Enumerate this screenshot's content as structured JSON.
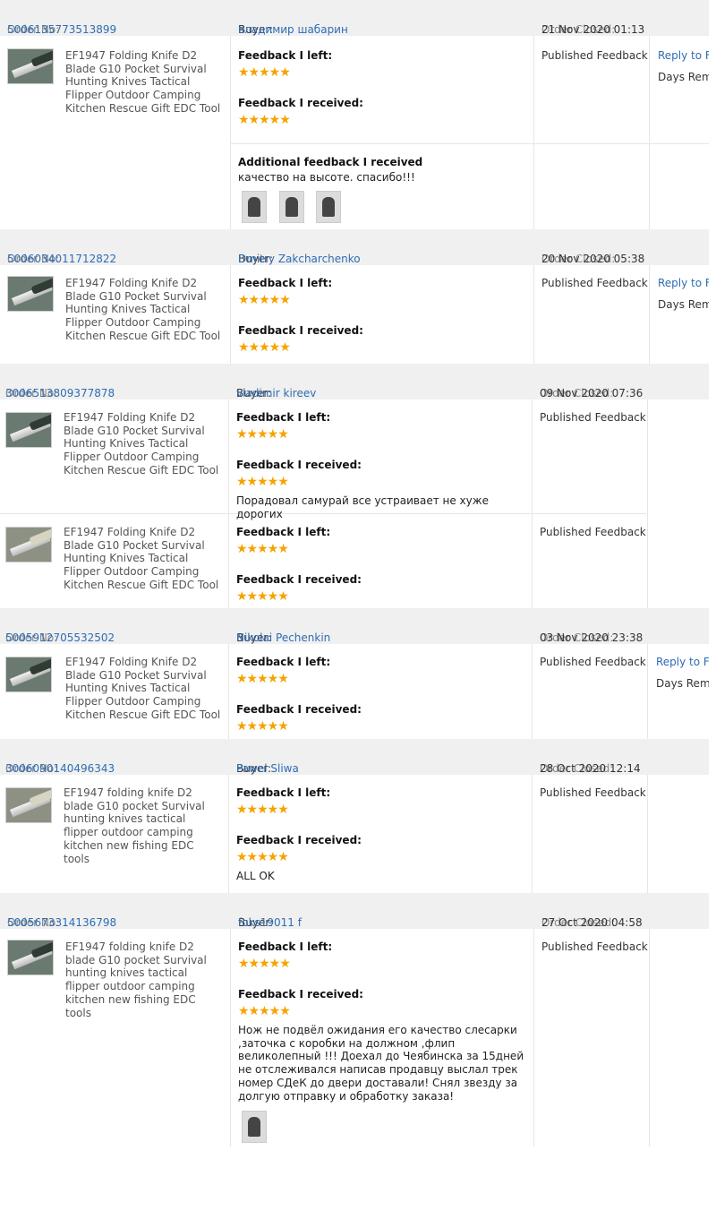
{
  "labels": {
    "order_no": "Order No:",
    "buyer": "Buyer:",
    "order_closed": "Order Closed:",
    "feedback_left": "Feedback I left:",
    "feedback_received": "Feedback I received:",
    "additional_feedback": "Additional feedback I received",
    "published": "Published Feedback",
    "reply": "Reply to Fe",
    "days": "Days Rema"
  },
  "orders": [
    {
      "order_no": "5006135773513899",
      "buyer": "владимир шабарин",
      "closed": "21 Nov 2020 01:13",
      "items": [
        {
          "title": "EF1947 Folding Knife D2 Blade G10 Pocket Survival Hunting Knives Tactical Flipper Outdoor Camping Kitchen Rescue Gift EDC Tool",
          "stars_left": "★★★★★",
          "stars_received": "★★★★★",
          "additional": "качество на высоте. спасибо!!!"
        }
      ]
    },
    {
      "order_no": "5006034011712822",
      "buyer": "Dmitry Zakcharchenko",
      "closed": "20 Nov 2020 05:38",
      "items": [
        {
          "title": "EF1947 Folding Knife D2 Blade G10 Pocket Survival Hunting Knives Tactical Flipper Outdoor Camping Kitchen Rescue Gift EDC Tool",
          "stars_left": "★★★★★",
          "stars_received": "★★★★★"
        }
      ]
    },
    {
      "order_no": "3006513809377878",
      "buyer": "vladimir kireev",
      "closed": "09 Nov 2020 07:36",
      "items": [
        {
          "title": "EF1947 Folding Knife D2 Blade G10 Pocket Survival Hunting Knives Tactical Flipper Outdoor Camping Kitchen Rescue Gift EDC Tool",
          "stars_left": "★★★★★",
          "stars_received": "★★★★★",
          "comment": "Порадовал самурай все устраивает не хуже дорогих"
        },
        {
          "title": "EF1947 Folding Knife D2 Blade G10 Pocket Survival Hunting Knives Tactical Flipper Outdoor Camping Kitchen Rescue Gift EDC Tool",
          "stars_left": "★★★★★",
          "stars_received": "★★★★★"
        }
      ]
    },
    {
      "order_no": "5005912705532502",
      "buyer": "Nikolai Pechenkin",
      "closed": "03 Nov 2020 23:38",
      "items": [
        {
          "title": "EF1947 Folding Knife D2 Blade G10 Pocket Survival Hunting Knives Tactical Flipper Outdoor Camping Kitchen Rescue Gift EDC Tool",
          "stars_left": "★★★★★",
          "stars_received": "★★★★★"
        }
      ]
    },
    {
      "order_no": "3006090140496343",
      "buyer": "Pawel Sliwa",
      "closed": "28 Oct 2020 12:14",
      "items": [
        {
          "title": "EF1947 folding knife D2 blade G10 pocket Survival hunting knives tactical flipper outdoor camping kitchen new fishing EDC tools",
          "stars_left": "★★★★★",
          "stars_received": "★★★★★",
          "comment": "ALL OK"
        }
      ]
    },
    {
      "order_no": "5005673314136798",
      "buyer": "foks19011 f",
      "closed": "27 Oct 2020 04:58",
      "items": [
        {
          "title": "EF1947 folding knife D2 blade G10 pocket Survival hunting knives tactical flipper outdoor camping kitchen new fishing EDC tools",
          "stars_left": "★★★★★",
          "stars_received": "★★★★★",
          "comment": "Нож не подвёл ожидания его качество слесарки ,заточка с коробки на должном ,флип великолепный !!! Доехал до Чеябинска за 15дней не отслеживался написав продавцу выслал трек номер СДеК до двери доставали! Снял звезду за долгую отправку и обработку заказа!"
        }
      ]
    }
  ]
}
